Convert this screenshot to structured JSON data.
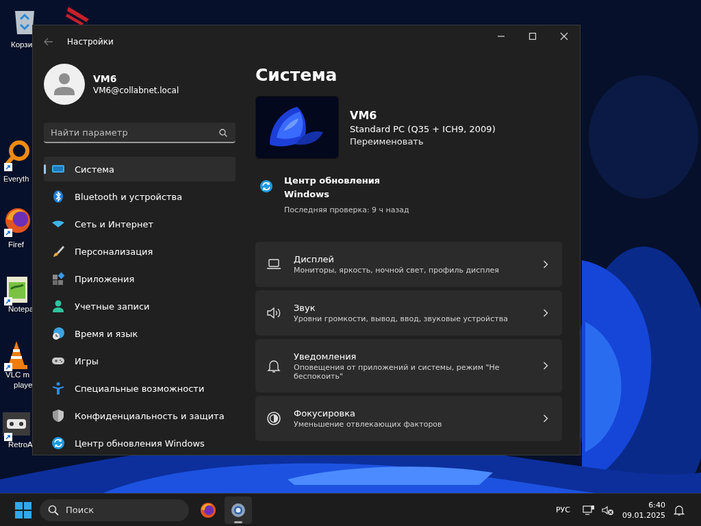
{
  "desktop_icons": [
    {
      "kind": "bin",
      "labels": [
        "Корзи"
      ]
    },
    {
      "kind": "stripes"
    },
    {
      "kind": "search",
      "labels": [
        "Everyth"
      ]
    },
    {
      "kind": "fox",
      "labels": [
        "Firef"
      ]
    },
    {
      "kind": "notepad",
      "labels": [
        "Notepa"
      ]
    },
    {
      "kind": "cone",
      "labels": [
        "VLC m",
        "playe"
      ]
    },
    {
      "kind": "gamepad",
      "labels": [
        "RetroA"
      ]
    }
  ],
  "window": {
    "title": "Настройки"
  },
  "account": {
    "name": "VM6",
    "email": "VM6@collabnet.local"
  },
  "search": {
    "placeholder": "Найти параметр"
  },
  "sidebar": {
    "items": [
      {
        "label": "Система",
        "selected": true
      },
      {
        "label": "Bluetooth и устройства",
        "selected": false
      },
      {
        "label": "Сеть и Интернет",
        "selected": false
      },
      {
        "label": "Персонализация",
        "selected": false
      },
      {
        "label": "Приложения",
        "selected": false
      },
      {
        "label": "Учетные записи",
        "selected": false
      },
      {
        "label": "Время и язык",
        "selected": false
      },
      {
        "label": "Игры",
        "selected": false
      },
      {
        "label": "Специальные возможности",
        "selected": false
      },
      {
        "label": "Конфиденциальность и защита",
        "selected": false
      },
      {
        "label": "Центр обновления Windows",
        "selected": false
      }
    ]
  },
  "page": {
    "title": "Система",
    "device": {
      "name": "VM6",
      "model": "Standard PC (Q35 + ICH9, 2009)",
      "rename": "Переименовать"
    },
    "update": {
      "title_lines": [
        "Центр обновления",
        "Windows"
      ],
      "status": "Последняя проверка: 9 ч назад"
    },
    "cards": [
      {
        "title": "Дисплей",
        "subtitle": "Мониторы, яркость, ночной свет, профиль дисплея"
      },
      {
        "title": "Звук",
        "subtitle": "Уровни громкости, вывод, ввод, звуковые устройства"
      },
      {
        "title": "Уведомления",
        "subtitle": "Оповещения от приложений и системы, режим \"Не беспокоить\""
      },
      {
        "title": "Фокусировка",
        "subtitle": "Уменьшение отвлекающих факторов"
      }
    ]
  },
  "taskbar": {
    "search_placeholder": "Поиск",
    "apps": [
      {
        "kind": "fox",
        "selected": false
      },
      {
        "kind": "gear",
        "selected": true
      }
    ],
    "language": "РУС",
    "time": "6:40",
    "date": "09.01.2025"
  }
}
